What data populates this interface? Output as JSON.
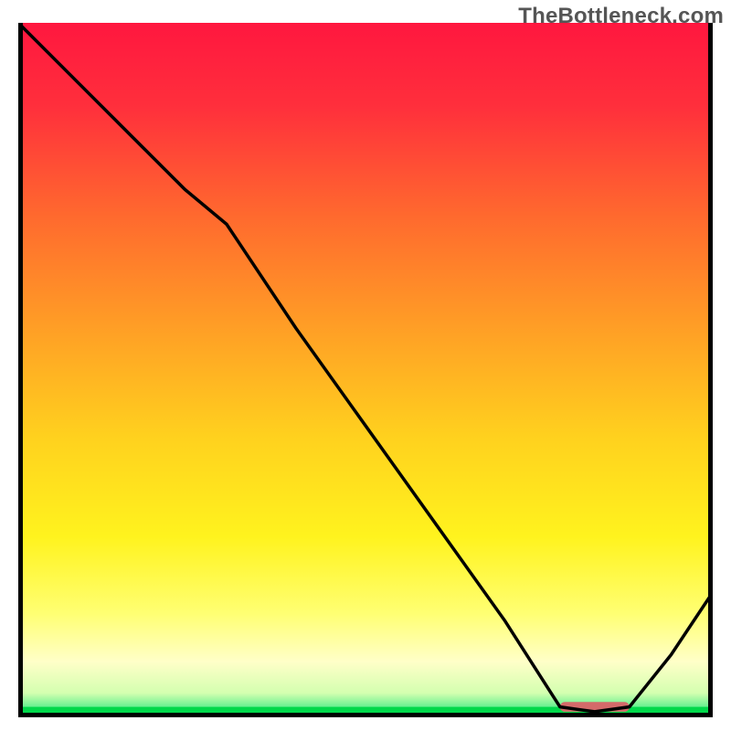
{
  "watermark": "TheBottleneck.com",
  "colors": {
    "frame": "#000000",
    "curve": "#000000",
    "green_band": "#00d84a",
    "sweet_marker": "#d46a6a",
    "gradient_stops": [
      {
        "offset": 0.0,
        "color": "#ff173f"
      },
      {
        "offset": 0.12,
        "color": "#ff2f3c"
      },
      {
        "offset": 0.28,
        "color": "#ff6a2e"
      },
      {
        "offset": 0.45,
        "color": "#ffa225"
      },
      {
        "offset": 0.6,
        "color": "#ffd21e"
      },
      {
        "offset": 0.74,
        "color": "#fff31e"
      },
      {
        "offset": 0.85,
        "color": "#ffff72"
      },
      {
        "offset": 0.92,
        "color": "#ffffc8"
      },
      {
        "offset": 0.965,
        "color": "#d4ffb0"
      },
      {
        "offset": 0.985,
        "color": "#66f090"
      },
      {
        "offset": 1.0,
        "color": "#00d84a"
      }
    ]
  },
  "chart_data": {
    "type": "line",
    "title": "",
    "xlabel": "",
    "ylabel": "",
    "xlim": [
      0,
      100
    ],
    "ylim": [
      0,
      100
    ],
    "green_band_height_pct": 1.5,
    "sweet_spot": {
      "x_start": 78,
      "x_end": 88,
      "y": 1.5,
      "thickness_pct": 1.4
    },
    "frame_stroke_width": 5,
    "curve_stroke_width": 3.5,
    "series": [
      {
        "name": "bottleneck",
        "x": [
          0,
          8,
          16,
          24,
          30,
          40,
          50,
          60,
          70,
          78,
          83,
          88,
          94,
          100
        ],
        "y": [
          100,
          92,
          84,
          76,
          71,
          56,
          42,
          28,
          14,
          1.5,
          0.8,
          1.5,
          9,
          18
        ]
      }
    ]
  }
}
